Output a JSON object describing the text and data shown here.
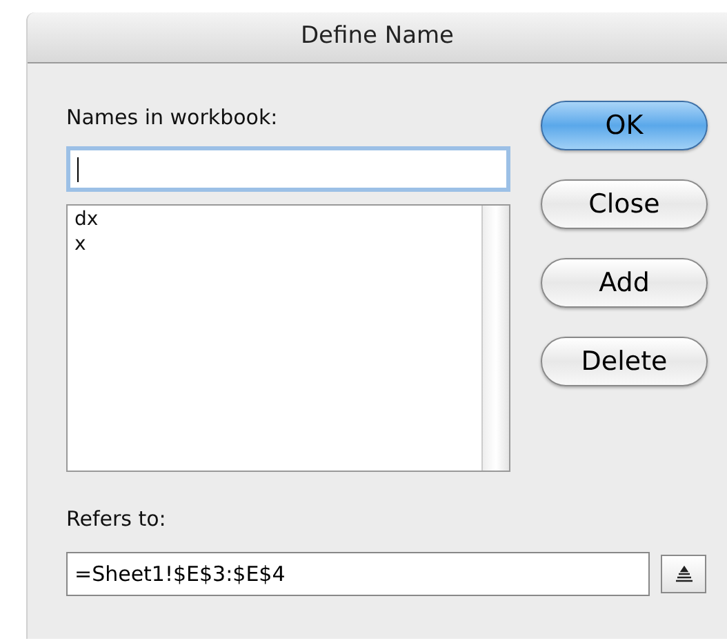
{
  "window": {
    "title": "Define Name"
  },
  "names_label": "Names in workbook:",
  "name_field": {
    "focused": true
  },
  "names_list": [
    {
      "label": "dx",
      "selected": false
    },
    {
      "label": "x",
      "selected": false
    }
  ],
  "buttons": [
    {
      "label": "OK",
      "kind": "default"
    },
    {
      "label": "Close",
      "kind": "normal"
    },
    {
      "label": "Add",
      "kind": "normal"
    },
    {
      "label": "Delete",
      "kind": "normal"
    }
  ],
  "refers_label": "Refers to:",
  "refers_field": {
    "value": "=Sheet1!$E$3:$E$4"
  }
}
